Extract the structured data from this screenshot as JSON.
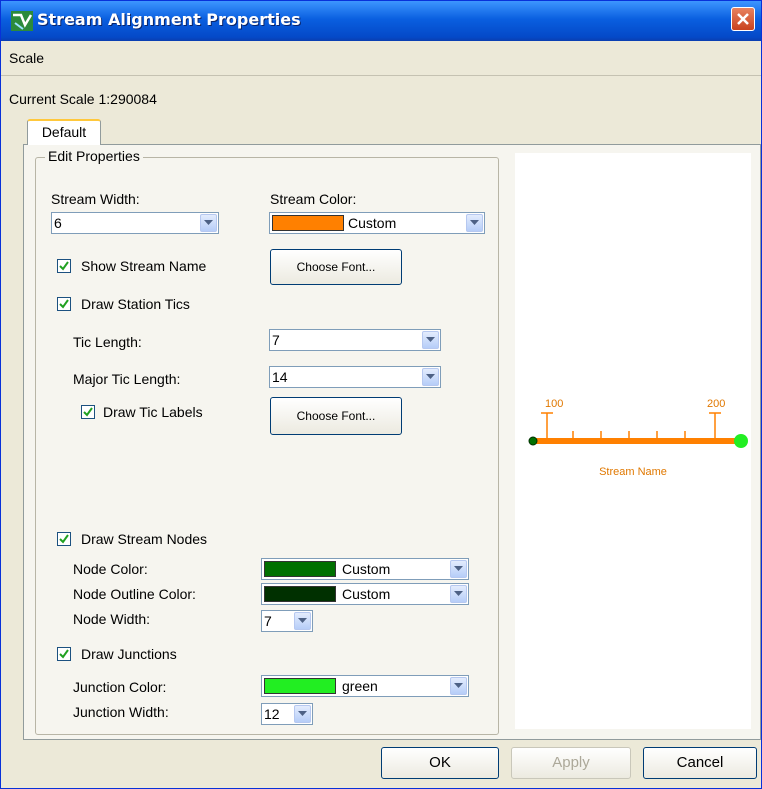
{
  "window": {
    "title": "Stream Alignment Properties"
  },
  "menu": {
    "items": [
      "Scale"
    ]
  },
  "scale_label": "Current Scale 1:290084",
  "tabs": [
    "Default"
  ],
  "group_title": "Edit Properties",
  "stream_width": {
    "label": "Stream Width:",
    "value": "6"
  },
  "stream_color": {
    "label": "Stream Color:",
    "value": "Custom",
    "color": "#ff8000"
  },
  "show_stream_name": {
    "label": "Show Stream Name",
    "checked": true
  },
  "choose_font_1": "Choose Font...",
  "draw_station_tics": {
    "label": "Draw Station Tics",
    "checked": true
  },
  "tic_length": {
    "label": "Tic Length:",
    "value": "7"
  },
  "major_tic_length": {
    "label": "Major Tic Length:",
    "value": "14"
  },
  "draw_tic_labels": {
    "label": "Draw Tic Labels",
    "checked": true
  },
  "choose_font_2": "Choose Font...",
  "draw_stream_nodes": {
    "label": "Draw Stream Nodes",
    "checked": true
  },
  "node_color": {
    "label": "Node Color:",
    "value": "Custom",
    "color": "#007000"
  },
  "node_outline_color": {
    "label": "Node Outline Color:",
    "value": "Custom",
    "color": "#003000"
  },
  "node_width": {
    "label": "Node Width:",
    "value": "7"
  },
  "draw_junctions": {
    "label": "Draw Junctions",
    "checked": true
  },
  "junction_color": {
    "label": "Junction Color:",
    "value": "green",
    "color": "#22ee22"
  },
  "junction_width": {
    "label": "Junction Width:",
    "value": "12"
  },
  "preview": {
    "tic_label_start": "100",
    "tic_label_end": "200",
    "stream_name": "Stream Name",
    "stream_color": "#ff8000",
    "node_color": "#007000",
    "junction_color": "#22ee22"
  },
  "buttons": {
    "ok": "OK",
    "apply": "Apply",
    "cancel": "Cancel"
  }
}
